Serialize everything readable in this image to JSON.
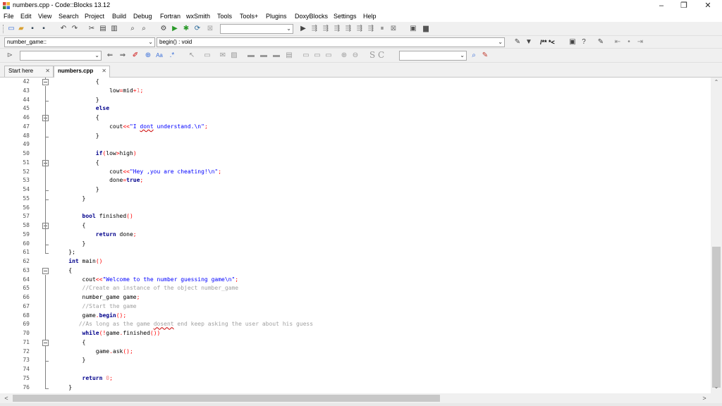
{
  "window": {
    "title": "numbers.cpp - Code::Blocks 13.12",
    "minimize": "–",
    "restore": "❐",
    "close": "✕"
  },
  "menu": [
    "File",
    "Edit",
    "View",
    "Search",
    "Project",
    "Build",
    "Debug",
    "Fortran",
    "wxSmith",
    "Tools",
    "Tools+",
    "Plugins",
    "DoxyBlocks",
    "Settings",
    "Help"
  ],
  "toolbar": {
    "scope_combo": "number_game::",
    "function_combo": "begin() : void",
    "doc_comment_label": "/** *<",
    "find_label": "S C"
  },
  "tabs": [
    {
      "label": "Start here",
      "close": "✕"
    },
    {
      "label": "numbers.cpp",
      "close": "✕"
    }
  ],
  "editor": {
    "first_line": 42,
    "lines": [
      {
        "n": 42,
        "parts": [
          {
            "t": "            {",
            "c": ""
          }
        ]
      },
      {
        "n": 43,
        "parts": [
          {
            "t": "                low",
            "c": ""
          },
          {
            "t": "=",
            "c": "op"
          },
          {
            "t": "mid",
            "c": ""
          },
          {
            "t": "+",
            "c": "op"
          },
          {
            "t": "1",
            "c": "num"
          },
          {
            "t": ";",
            "c": "op"
          }
        ]
      },
      {
        "n": 44,
        "parts": [
          {
            "t": "            }",
            "c": ""
          }
        ]
      },
      {
        "n": 45,
        "parts": [
          {
            "t": "            ",
            "c": ""
          },
          {
            "t": "else",
            "c": "kw"
          }
        ]
      },
      {
        "n": 46,
        "parts": [
          {
            "t": "            {",
            "c": ""
          }
        ]
      },
      {
        "n": 47,
        "parts": [
          {
            "t": "                cout",
            "c": ""
          },
          {
            "t": "<<",
            "c": "op"
          },
          {
            "t": "\"I ",
            "c": "str"
          },
          {
            "t": "dont",
            "c": "str sq"
          },
          {
            "t": " understand.\\n\"",
            "c": "str"
          },
          {
            "t": ";",
            "c": "op"
          }
        ]
      },
      {
        "n": 48,
        "parts": [
          {
            "t": "            }",
            "c": ""
          }
        ]
      },
      {
        "n": 49,
        "parts": [
          {
            "t": "",
            "c": ""
          }
        ]
      },
      {
        "n": 50,
        "parts": [
          {
            "t": "            ",
            "c": ""
          },
          {
            "t": "if",
            "c": "kw"
          },
          {
            "t": "(",
            "c": "op"
          },
          {
            "t": "low",
            "c": ""
          },
          {
            "t": ">",
            "c": "op"
          },
          {
            "t": "high",
            "c": ""
          },
          {
            "t": ")",
            "c": "op"
          }
        ]
      },
      {
        "n": 51,
        "parts": [
          {
            "t": "            {",
            "c": ""
          }
        ]
      },
      {
        "n": 52,
        "parts": [
          {
            "t": "                cout",
            "c": ""
          },
          {
            "t": "<<",
            "c": "op"
          },
          {
            "t": "\"Hey ,you are cheating!\\n\"",
            "c": "str"
          },
          {
            "t": ";",
            "c": "op"
          }
        ]
      },
      {
        "n": 53,
        "parts": [
          {
            "t": "                done",
            "c": ""
          },
          {
            "t": "=",
            "c": "op"
          },
          {
            "t": "true",
            "c": "kw"
          },
          {
            "t": ";",
            "c": "op"
          }
        ]
      },
      {
        "n": 54,
        "parts": [
          {
            "t": "            }",
            "c": ""
          }
        ]
      },
      {
        "n": 55,
        "parts": [
          {
            "t": "        }",
            "c": ""
          }
        ]
      },
      {
        "n": 56,
        "parts": [
          {
            "t": "",
            "c": ""
          }
        ]
      },
      {
        "n": 57,
        "parts": [
          {
            "t": "        ",
            "c": ""
          },
          {
            "t": "bool",
            "c": "kw"
          },
          {
            "t": " finished",
            "c": ""
          },
          {
            "t": "()",
            "c": "op"
          }
        ]
      },
      {
        "n": 58,
        "parts": [
          {
            "t": "        {",
            "c": ""
          }
        ]
      },
      {
        "n": 59,
        "parts": [
          {
            "t": "            ",
            "c": ""
          },
          {
            "t": "return",
            "c": "kw"
          },
          {
            "t": " done",
            "c": ""
          },
          {
            "t": ";",
            "c": "op"
          }
        ]
      },
      {
        "n": 60,
        "parts": [
          {
            "t": "        }",
            "c": ""
          }
        ]
      },
      {
        "n": 61,
        "parts": [
          {
            "t": "    };",
            "c": ""
          }
        ]
      },
      {
        "n": 62,
        "parts": [
          {
            "t": "    ",
            "c": ""
          },
          {
            "t": "int",
            "c": "kw"
          },
          {
            "t": " main",
            "c": ""
          },
          {
            "t": "()",
            "c": "op"
          }
        ]
      },
      {
        "n": 63,
        "parts": [
          {
            "t": "    {",
            "c": ""
          }
        ]
      },
      {
        "n": 64,
        "parts": [
          {
            "t": "        cout",
            "c": ""
          },
          {
            "t": "<<",
            "c": "op"
          },
          {
            "t": "\"Welcome to the number guessing game\\n\"",
            "c": "str"
          },
          {
            "t": ";",
            "c": "op"
          }
        ]
      },
      {
        "n": 65,
        "parts": [
          {
            "t": "        //Create an instance of the object number_game",
            "c": "cm"
          }
        ]
      },
      {
        "n": 66,
        "parts": [
          {
            "t": "        number_game game",
            "c": ""
          },
          {
            "t": ";",
            "c": "op"
          }
        ]
      },
      {
        "n": 67,
        "parts": [
          {
            "t": "        //Start the game",
            "c": "cm"
          }
        ]
      },
      {
        "n": 68,
        "parts": [
          {
            "t": "        game",
            "c": ""
          },
          {
            "t": ".",
            "c": "op"
          },
          {
            "t": "begin",
            "c": "kw"
          },
          {
            "t": "();",
            "c": "op"
          }
        ]
      },
      {
        "n": 69,
        "parts": [
          {
            "t": "       //As long as the game ",
            "c": "cm"
          },
          {
            "t": "dosent",
            "c": "cm sq"
          },
          {
            "t": " end keep asking the user about his guess",
            "c": "cm"
          }
        ]
      },
      {
        "n": 70,
        "parts": [
          {
            "t": "        ",
            "c": ""
          },
          {
            "t": "while",
            "c": "kw"
          },
          {
            "t": "(!",
            "c": "op"
          },
          {
            "t": "game",
            "c": ""
          },
          {
            "t": ".",
            "c": "op"
          },
          {
            "t": "finished",
            "c": ""
          },
          {
            "t": "())",
            "c": "op"
          }
        ]
      },
      {
        "n": 71,
        "parts": [
          {
            "t": "        {",
            "c": ""
          }
        ]
      },
      {
        "n": 72,
        "parts": [
          {
            "t": "            game",
            "c": ""
          },
          {
            "t": ".",
            "c": "op"
          },
          {
            "t": "ask",
            "c": ""
          },
          {
            "t": "();",
            "c": "op"
          }
        ]
      },
      {
        "n": 73,
        "parts": [
          {
            "t": "        }",
            "c": ""
          }
        ]
      },
      {
        "n": 74,
        "parts": [
          {
            "t": "",
            "c": ""
          }
        ]
      },
      {
        "n": 75,
        "parts": [
          {
            "t": "        ",
            "c": ""
          },
          {
            "t": "return",
            "c": "kw"
          },
          {
            "t": " ",
            "c": ""
          },
          {
            "t": "0",
            "c": "num"
          },
          {
            "t": ";",
            "c": "op"
          }
        ]
      },
      {
        "n": 76,
        "parts": [
          {
            "t": "    }",
            "c": ""
          }
        ]
      }
    ]
  },
  "scroll": {
    "up": "⌃",
    "down": "⌄",
    "left": "<",
    "right": ">"
  }
}
